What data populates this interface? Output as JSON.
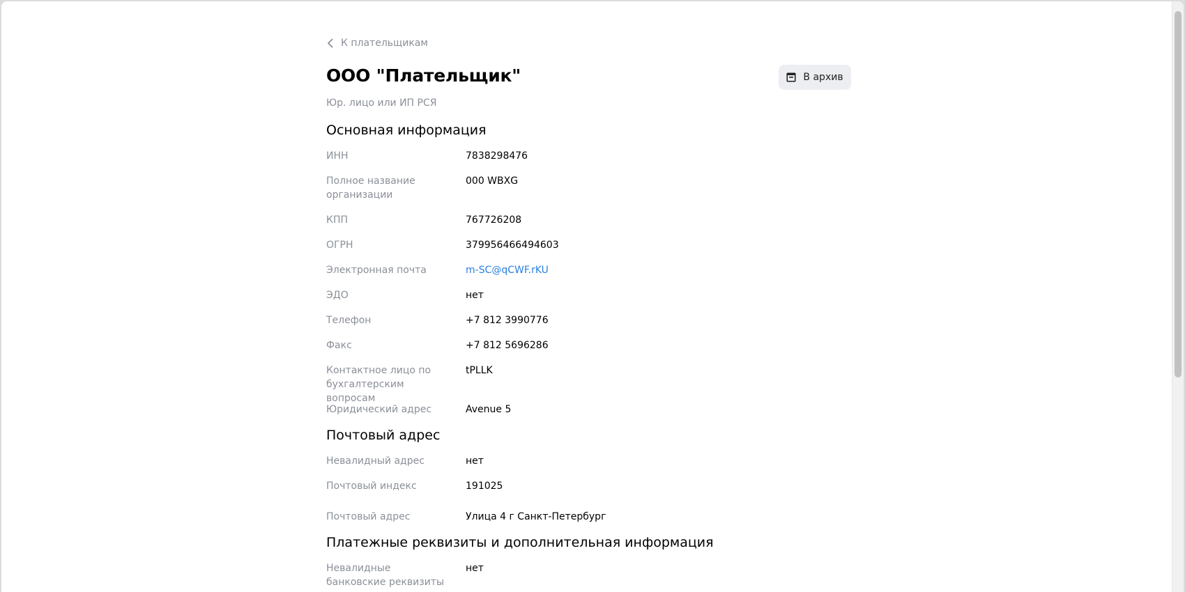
{
  "back_link": {
    "label": "К плательщикам",
    "icon": "chevron-left-icon"
  },
  "header": {
    "title": "ООО \"Плательщик\"",
    "subtitle": "Юр. лицо или ИП РСЯ",
    "archive_button": {
      "label": "В архив",
      "icon": "archive-icon"
    }
  },
  "sections": {
    "main_info": {
      "title": "Основная информация",
      "fields": [
        {
          "label": "ИНН",
          "value": "7838298476"
        },
        {
          "label": "Полное название организации",
          "value": "000 WBXG"
        },
        {
          "label": "КПП",
          "value": "767726208"
        },
        {
          "label": "ОГРН",
          "value": "379956466494603"
        },
        {
          "label": "Электронная почта",
          "value": "m-SC@qCWF.rKU"
        },
        {
          "label": "ЭДО",
          "value": "нет"
        },
        {
          "label": "Телефон",
          "value": "+7 812 3990776"
        },
        {
          "label": "Факс",
          "value": "+7 812 5696286"
        },
        {
          "label": "Контактное лицо по бухгалтерским вопросам",
          "value": "tPLLK"
        },
        {
          "label": "Юридический адрес",
          "value": "Avenue 5"
        }
      ]
    },
    "postal": {
      "title": "Почтовый адрес",
      "fields": [
        {
          "label": "Невалидный адрес",
          "value": "нет"
        },
        {
          "label": "Почтовый индекс",
          "value": "191025"
        },
        {
          "label": "Почтовый адрес",
          "value": "Улица 4 г Санкт-Петербург"
        }
      ]
    },
    "payment": {
      "title": "Платежные реквизиты и дополнительная информация",
      "fields": [
        {
          "label": "Невалидные банковские реквизиты",
          "value": "нет"
        }
      ]
    }
  },
  "colors": {
    "label": "#8a8f98",
    "link": "#2a80e0",
    "button_bg": "#eceef1"
  }
}
